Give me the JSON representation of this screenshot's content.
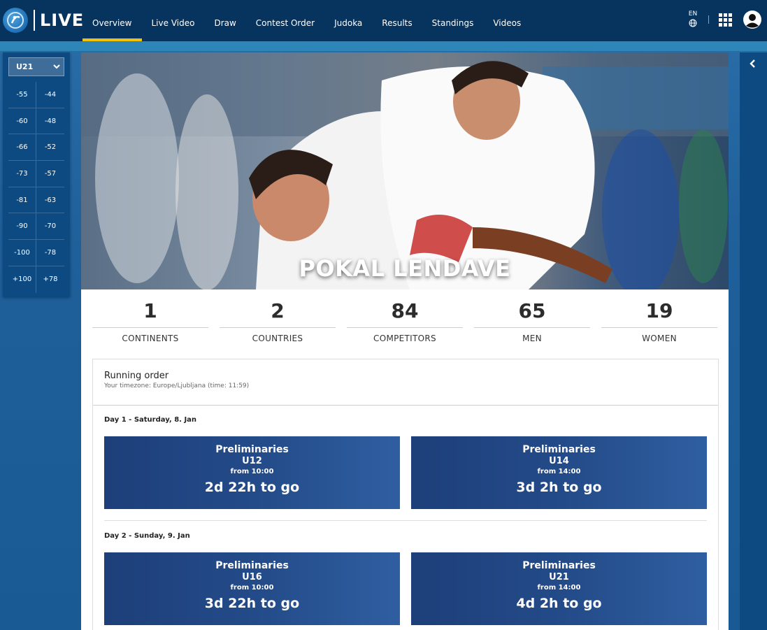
{
  "app": {
    "logo_text": "LIVE"
  },
  "nav": [
    {
      "label": "Overview",
      "active": true
    },
    {
      "label": "Live Video"
    },
    {
      "label": "Draw"
    },
    {
      "label": "Contest Order"
    },
    {
      "label": "Judoka"
    },
    {
      "label": "Results"
    },
    {
      "label": "Standings"
    },
    {
      "label": "Videos"
    }
  ],
  "header_right": {
    "lang": "EN"
  },
  "weights": {
    "selected": "U21",
    "rows": [
      [
        "-55",
        "-44"
      ],
      [
        "-60",
        "-48"
      ],
      [
        "-66",
        "-52"
      ],
      [
        "-73",
        "-57"
      ],
      [
        "-81",
        "-63"
      ],
      [
        "-90",
        "-70"
      ],
      [
        "-100",
        "-78"
      ],
      [
        "+100",
        "+78"
      ]
    ]
  },
  "event": {
    "title": "POKAL LENDAVE"
  },
  "stats": [
    {
      "value": "1",
      "label": "CONTINENTS"
    },
    {
      "value": "2",
      "label": "COUNTRIES"
    },
    {
      "value": "84",
      "label": "COMPETITORS"
    },
    {
      "value": "65",
      "label": "MEN"
    },
    {
      "value": "19",
      "label": "WOMEN"
    }
  ],
  "running_order": {
    "title": "Running order",
    "timezone": "Your timezone: Europe/Ljubljana (time: 11:59)",
    "days": [
      {
        "title": "Day 1 - Saturday, 8. Jan",
        "sessions": [
          {
            "phase": "Preliminaries",
            "category": "U12",
            "from": "from 10:00",
            "countdown": "2d 22h to go"
          },
          {
            "phase": "Preliminaries",
            "category": "U14",
            "from": "from 14:00",
            "countdown": "3d 2h to go"
          }
        ]
      },
      {
        "title": "Day 2 - Sunday, 9. Jan",
        "sessions": [
          {
            "phase": "Preliminaries",
            "category": "U16",
            "from": "from 10:00",
            "countdown": "3d 22h to go"
          },
          {
            "phase": "Preliminaries",
            "category": "U21",
            "from": "from 14:00",
            "countdown": "4d 2h to go"
          }
        ]
      }
    ]
  }
}
